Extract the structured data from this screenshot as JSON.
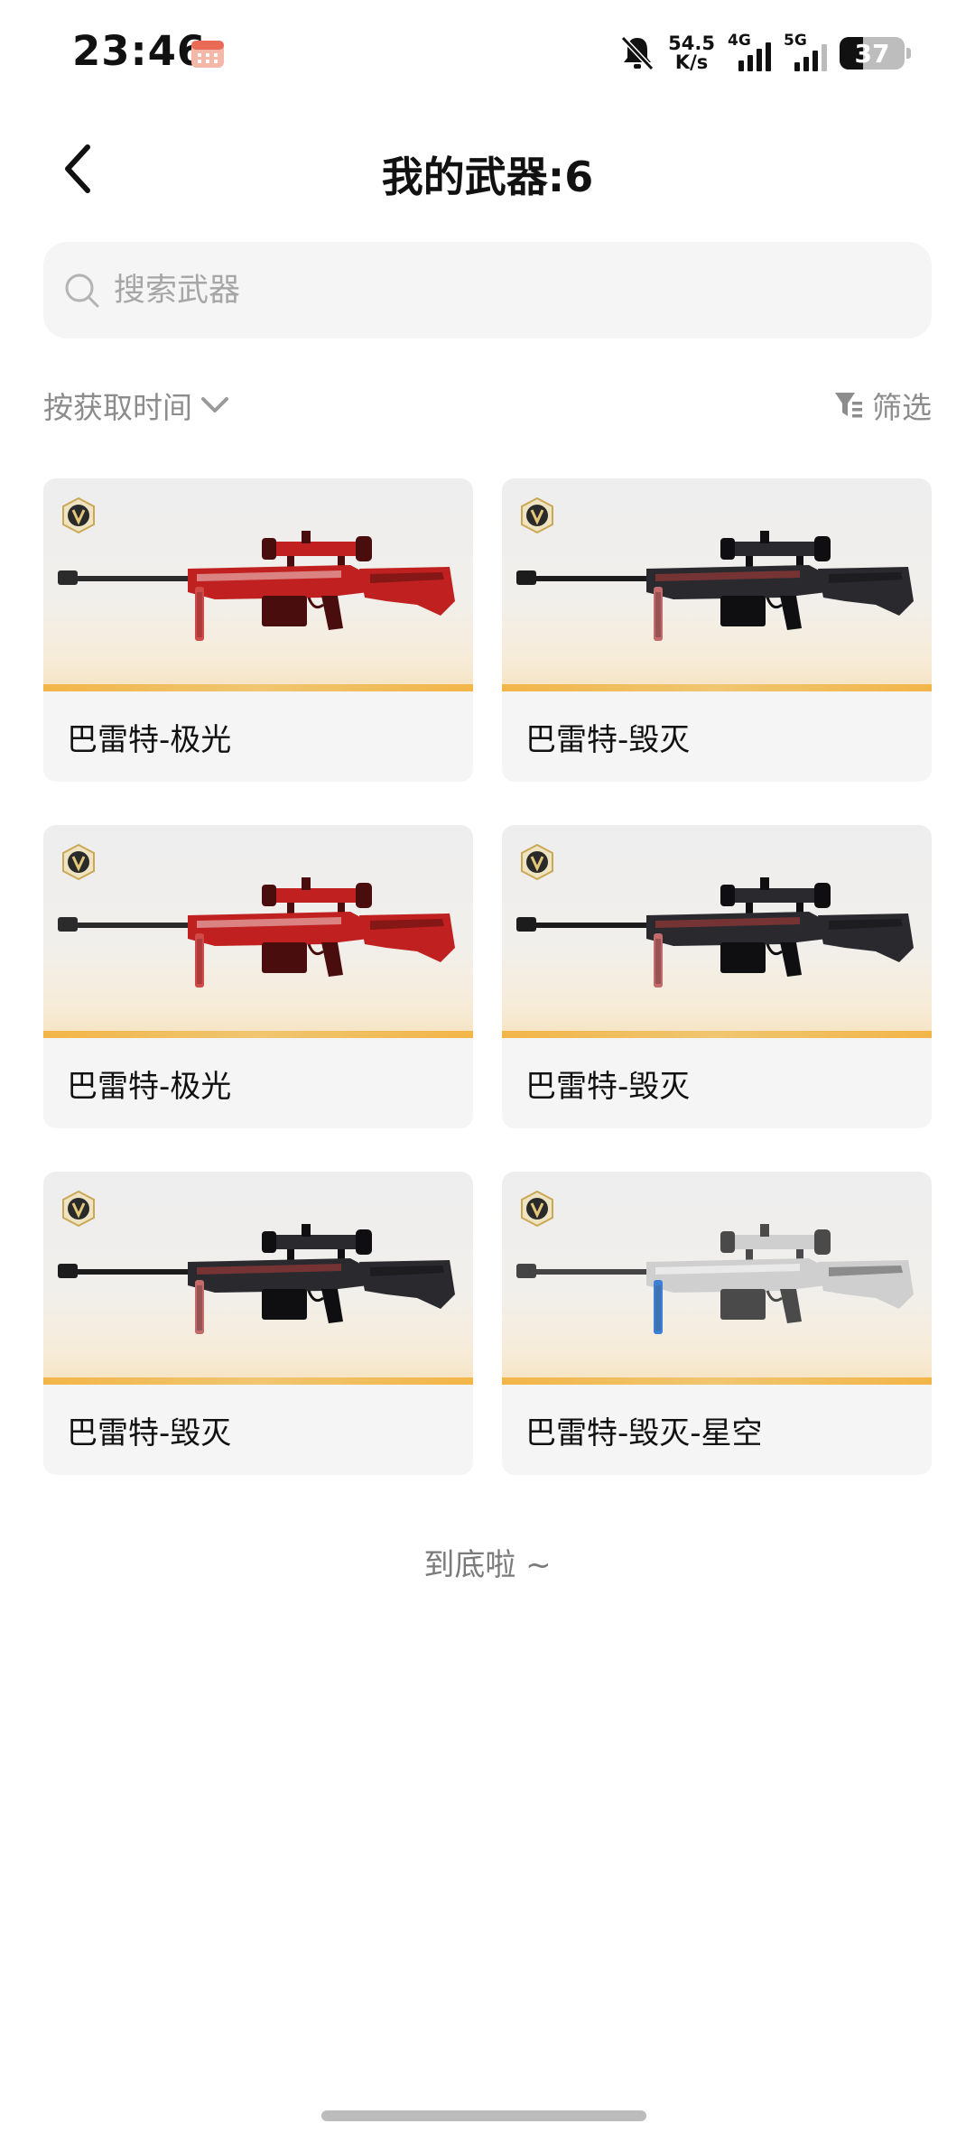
{
  "status_bar": {
    "time": "23:46",
    "speed_value": "54.5",
    "speed_unit": "K/s",
    "network_1": "4G",
    "network_2": "5G",
    "battery": "37"
  },
  "header": {
    "title": "我的武器:6"
  },
  "search": {
    "placeholder": "搜索武器",
    "value": ""
  },
  "toolbar": {
    "sort_label": "按获取时间",
    "filter_label": "筛选"
  },
  "weapons": [
    {
      "name": "巴雷特-极光",
      "skin": "red"
    },
    {
      "name": "巴雷特-毁灭",
      "skin": "dark"
    },
    {
      "name": "巴雷特-极光",
      "skin": "red"
    },
    {
      "name": "巴雷特-毁灭",
      "skin": "dark"
    },
    {
      "name": "巴雷特-毁灭",
      "skin": "dark"
    },
    {
      "name": "巴雷特-毁灭-星空",
      "skin": "silver"
    }
  ],
  "footer": {
    "end_text": "到底啦 ~"
  },
  "colors": {
    "accent_stripe": "#f2b548",
    "badge_gold": "#c9a957",
    "red_skin": "#c0201f",
    "dark_skin": "#2a2a2e",
    "silver_skin": "#cfcfcf"
  }
}
